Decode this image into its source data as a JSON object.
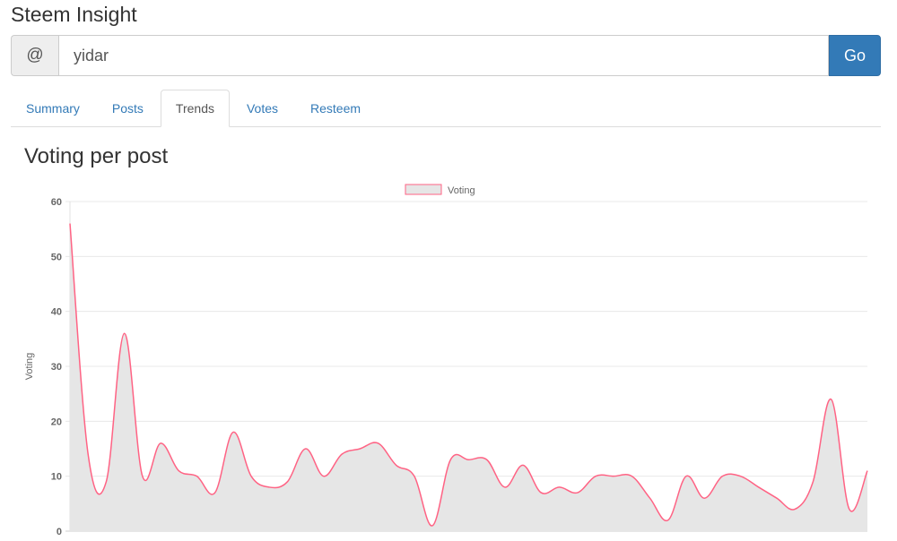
{
  "app": {
    "title": "Steem Insight"
  },
  "search": {
    "prefix": "@",
    "value": "yidar",
    "go_label": "Go"
  },
  "tabs": [
    {
      "label": "Summary",
      "active": false
    },
    {
      "label": "Posts",
      "active": false
    },
    {
      "label": "Trends",
      "active": true
    },
    {
      "label": "Votes",
      "active": false
    },
    {
      "label": "Resteem",
      "active": false
    }
  ],
  "section": {
    "title": "Voting per post"
  },
  "chart_data": {
    "type": "area",
    "title": "",
    "ylabel": "Voting",
    "xlabel": "",
    "ylim": [
      0,
      60
    ],
    "yticks": [
      0,
      10,
      20,
      30,
      40,
      50,
      60
    ],
    "grid": true,
    "legend": "top-center",
    "colors": {
      "line": "#ff6384",
      "fill": "#e6e6e6"
    },
    "series": [
      {
        "name": "Voting",
        "values": [
          56,
          14,
          9,
          36,
          10,
          16,
          11,
          10,
          7,
          18,
          10,
          8,
          9,
          15,
          10,
          14,
          15,
          16,
          12,
          10,
          1,
          13,
          13,
          13,
          8,
          12,
          7,
          8,
          7,
          10,
          10,
          10,
          6,
          2,
          10,
          6,
          10,
          10,
          8,
          6,
          4,
          9,
          24,
          4,
          11
        ]
      }
    ]
  }
}
